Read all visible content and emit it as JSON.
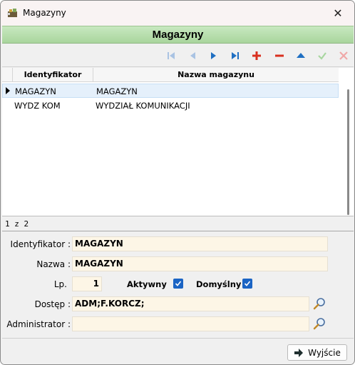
{
  "window": {
    "title": "Magazyny",
    "app_icon": "toolbox-icon",
    "close_label": "✕"
  },
  "header": {
    "title": "Magazyny"
  },
  "toolbar": {
    "buttons": [
      {
        "name": "first-record",
        "icon": "skip-first-icon",
        "enabled": false
      },
      {
        "name": "prior-record",
        "icon": "triangle-left-icon",
        "enabled": false
      },
      {
        "name": "next-record",
        "icon": "triangle-right-icon",
        "enabled": true
      },
      {
        "name": "last-record",
        "icon": "skip-last-icon",
        "enabled": true
      },
      {
        "name": "insert",
        "icon": "plus-icon",
        "enabled": true
      },
      {
        "name": "delete",
        "icon": "minus-icon",
        "enabled": true
      },
      {
        "name": "edit",
        "icon": "triangle-up-icon",
        "enabled": true
      },
      {
        "name": "post",
        "icon": "check-icon",
        "enabled": false
      },
      {
        "name": "cancel",
        "icon": "x-icon",
        "enabled": false
      }
    ],
    "colors": {
      "nav_enabled": "#1f6fc2",
      "nav_disabled": "#a9c3e3",
      "red": "#d9301f",
      "green_disabled": "#a8d6a0",
      "red_disabled": "#f0a8a8"
    }
  },
  "grid": {
    "columns": [
      "Identyfikator",
      "Nazwa magazynu"
    ],
    "rows": [
      {
        "id": "MAGAZYN",
        "name": "MAGAZYN",
        "selected": true
      },
      {
        "id": "WYDZ KOM",
        "name": "WYDZIAŁ KOMUNIKACJI",
        "selected": false
      }
    ]
  },
  "record_counter": "1 z 2",
  "form": {
    "identyfikator_label": "Identyfikator :",
    "identyfikator_value": "MAGAZYN",
    "nazwa_label": "Nazwa :",
    "nazwa_value": "MAGAZYN",
    "lp_label": "Lp.",
    "lp_value": "1",
    "aktywny_label": "Aktywny",
    "aktywny_checked": true,
    "domyslny_label": "Domyślny",
    "domyslny_checked": true,
    "dostep_label": "Dostęp :",
    "dostep_value": "ADM;F.KORCZ;",
    "administrator_label": "Administrator :",
    "administrator_value": ""
  },
  "footer": {
    "exit_label": "Wyjście"
  }
}
